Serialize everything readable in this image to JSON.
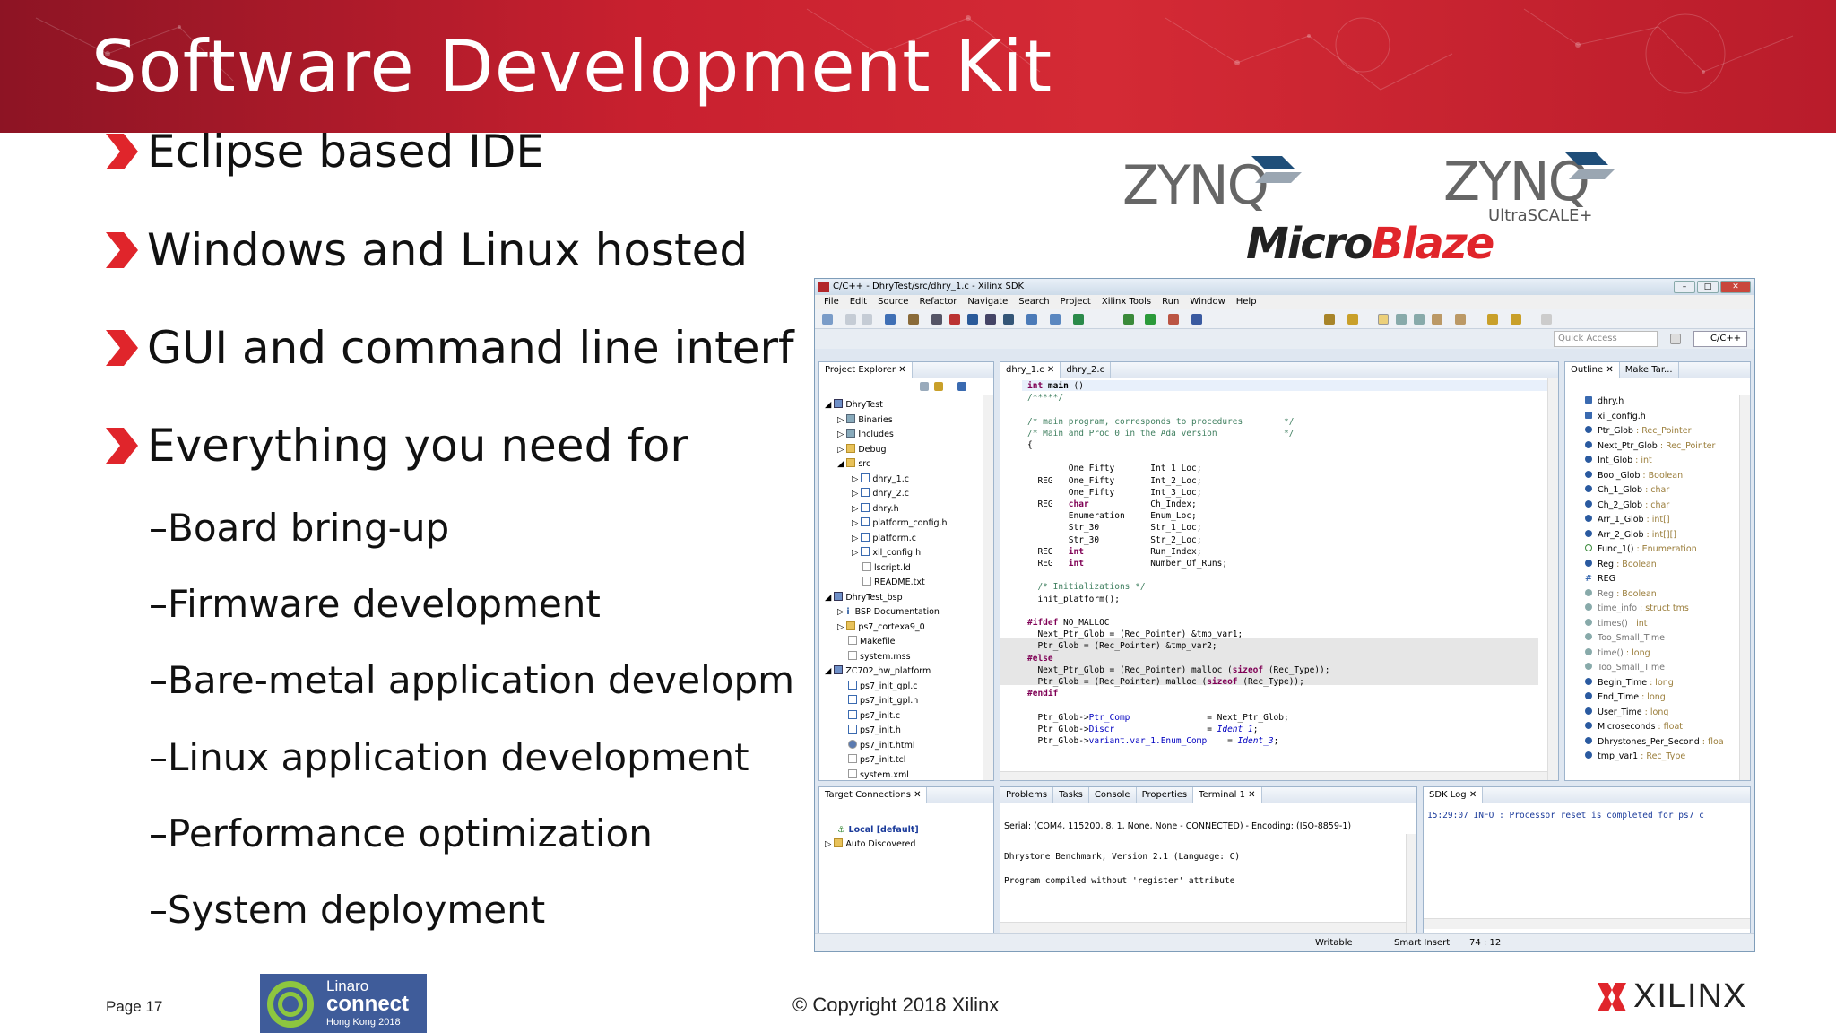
{
  "slide": {
    "title": "Software Development Kit",
    "bullets": [
      "Eclipse based  IDE",
      "Windows and Linux hosted",
      "GUI and command line interf",
      "Everything you need for"
    ],
    "sub_bullets": [
      "–Board bring-up",
      "–Firmware development",
      "–Bare-metal application developm",
      "–Linux application development",
      "–Performance optimization",
      "–System deployment"
    ],
    "page": "Page 17",
    "copyright": "© Copyright 2018 Xilinx",
    "accent_color": "#c8202f"
  },
  "logos": {
    "zynq1": "ZYNQ",
    "zynq2": "ZYNQ",
    "ultrascale": "UltraSCALE+",
    "microblaze_a": "Micro",
    "microblaze_b": "Blaze",
    "linaro_1": "Linaro",
    "linaro_2": "connect",
    "linaro_3": "Hong Kong 2018",
    "xilinx": "XILINX"
  },
  "ide": {
    "window_title": "C/C++ - DhryTest/src/dhry_1.c - Xilinx SDK",
    "menu": [
      "File",
      "Edit",
      "Source",
      "Refactor",
      "Navigate",
      "Search",
      "Project",
      "Xilinx Tools",
      "Run",
      "Window",
      "Help"
    ],
    "quick_access": "Quick Access",
    "perspective": "C/C++",
    "project_explorer": {
      "tab": "Project Explorer ✕",
      "items": [
        "DhryTest",
        "Binaries",
        "Includes",
        "Debug",
        "src",
        "dhry_1.c",
        "dhry_2.c",
        "dhry.h",
        "platform_config.h",
        "platform.c",
        "xil_config.h",
        "lscript.ld",
        "README.txt",
        "DhryTest_bsp",
        "BSP Documentation",
        "ps7_cortexa9_0",
        "Makefile",
        "system.mss",
        "ZC702_hw_platform",
        "ps7_init_gpl.c",
        "ps7_init_gpl.h",
        "ps7_init.c",
        "ps7_init.h",
        "ps7_init.html",
        "ps7_init.tcl",
        "system.xml"
      ]
    },
    "editor_tabs": [
      "dhry_1.c ✕",
      "dhry_2.c"
    ],
    "code": {
      "l1_kw": "int",
      "l1_fn": "main",
      "l1_rest": " ()",
      "l2": "/*****/",
      "c1": "/* main program, corresponds to procedures        */",
      "c2": "/* Main and Proc_0 in the Ada version             */",
      "brace_open": "{",
      "decl1": "        One_Fifty       Int_1_Loc;",
      "decl2": "  REG   One_Fifty       Int_2_Loc;",
      "decl3": "        One_Fifty       Int_3_Loc;",
      "decl4_a": "  REG   ",
      "decl4_kw": "char",
      "decl4_b": "            Ch_Index;",
      "decl5": "        Enumeration     Enum_Loc;",
      "decl6": "        Str_30          Str_1_Loc;",
      "decl7": "        Str_30          Str_2_Loc;",
      "decl8_a": "  REG   ",
      "decl8_kw": "int",
      "decl8_b": "             Run_Index;",
      "decl9_a": "  REG   ",
      "decl9_kw": "int",
      "decl9_b": "             Number_Of_Runs;",
      "init_c": "  /* Initializations */",
      "init": "  init_platform();",
      "ifdef_kw": "#ifdef",
      "ifdef_rest": " NO_MALLOC",
      "m1": "  Next_Ptr_Glob = (Rec_Pointer) &tmp_var1;",
      "m2": "  Ptr_Glob = (Rec_Pointer) &tmp_var2;",
      "else_kw": "#else",
      "m3_a": "  Next_Ptr_Glob = (Rec_Pointer) malloc (",
      "m3_kw": "sizeof",
      "m3_b": " (Rec_Type));",
      "m4_a": "  Ptr_Glob = (Rec_Pointer) malloc (",
      "m4_kw": "sizeof",
      "m4_b": " (Rec_Type));",
      "endif_kw": "#endif",
      "p1_a": "  Ptr_Glob->",
      "p1_f": "Ptr_Comp",
      "p1_b": "               = Next_Ptr_Glob;",
      "p2_a": "  Ptr_Glob->",
      "p2_f": "Discr",
      "p2_b": "                  = ",
      "p2_i": "Ident_1",
      "p2_c": ";",
      "p3_a": "  Ptr_Glob->",
      "p3_f": "variant.var_1.Enum_Comp",
      "p3_b": "    = ",
      "p3_i": "Ident_3",
      "p3_c": ";"
    },
    "outline_tabs": [
      "Outline ✕",
      "Make Tar..."
    ],
    "outline_items": [
      {
        "name": "dhry.h",
        "type": ""
      },
      {
        "name": "xil_config.h",
        "type": ""
      },
      {
        "name": "Ptr_Glob",
        "type": " : Rec_Pointer"
      },
      {
        "name": "Next_Ptr_Glob",
        "type": " : Rec_Pointer"
      },
      {
        "name": "Int_Glob",
        "type": " : int"
      },
      {
        "name": "Bool_Glob",
        "type": " : Boolean"
      },
      {
        "name": "Ch_1_Glob",
        "type": " : char"
      },
      {
        "name": "Ch_2_Glob",
        "type": " : char"
      },
      {
        "name": "Arr_1_Glob",
        "type": " : int[]"
      },
      {
        "name": "Arr_2_Glob",
        "type": " : int[][]"
      },
      {
        "name": "Func_1()",
        "type": " : Enumeration"
      },
      {
        "name": "Reg",
        "type": " : Boolean"
      },
      {
        "name": "REG",
        "type": ""
      },
      {
        "name": "Reg",
        "type": " : Boolean"
      },
      {
        "name": "time_info",
        "type": " : struct tms"
      },
      {
        "name": "times()",
        "type": " : int"
      },
      {
        "name": "Too_Small_Time",
        "type": ""
      },
      {
        "name": "time()",
        "type": " : long"
      },
      {
        "name": "Too_Small_Time",
        "type": ""
      },
      {
        "name": "Begin_Time",
        "type": " : long"
      },
      {
        "name": "End_Time",
        "type": " : long"
      },
      {
        "name": "User_Time",
        "type": " : long"
      },
      {
        "name": "Microseconds",
        "type": " : float"
      },
      {
        "name": "Dhrystones_Per_Second",
        "type": " : floa"
      },
      {
        "name": "tmp_var1",
        "type": " : Rec_Type"
      }
    ],
    "target_connections": {
      "tab": "Target Connections ✕",
      "items": [
        "Local [default]",
        "Auto Discovered"
      ]
    },
    "bottom_tabs": [
      "Problems",
      "Tasks",
      "Console",
      "Properties",
      "Terminal 1 ✕"
    ],
    "serial": "Serial: (COM4, 115200, 8, 1, None, None - CONNECTED) - Encoding: (ISO-8859-1)",
    "console_lines": [
      "Dhrystone Benchmark, Version 2.1 (Language: C)",
      "Program compiled without 'register' attribute"
    ],
    "sdk_log": {
      "tab": "SDK Log ✕",
      "line": "15:29:07 INFO   : Processor reset is completed for ps7_c"
    },
    "status": {
      "mode": "Writable",
      "insert": "Smart Insert",
      "pos": "74 : 12"
    }
  }
}
